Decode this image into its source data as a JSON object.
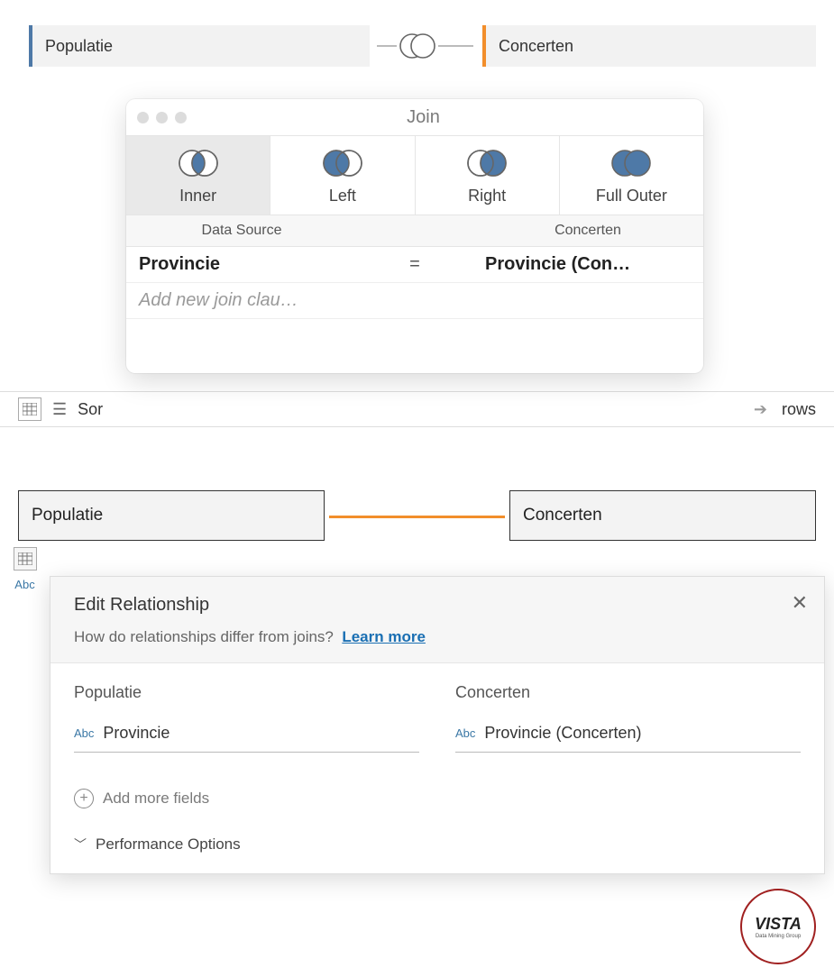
{
  "top": {
    "left_table": "Populatie",
    "right_table": "Concerten"
  },
  "join_popup": {
    "title": "Join",
    "types": [
      {
        "label": "Inner"
      },
      {
        "label": "Left"
      },
      {
        "label": "Right"
      },
      {
        "label": "Full Outer"
      }
    ],
    "headers": {
      "left": "Data Source",
      "right": "Concerten"
    },
    "clause": {
      "left": "Provincie",
      "op": "=",
      "right": "Provincie (Con…"
    },
    "add_placeholder": "Add new join clau…"
  },
  "toolstrip": {
    "sort_truncated": "Sor",
    "rows_label": "rows"
  },
  "relationship": {
    "left_table": "Populatie",
    "right_table": "Concerten",
    "title": "Edit Relationship",
    "subtitle": "How do relationships differ from joins?",
    "learn_more": "Learn more",
    "left_col": {
      "heading": "Populatie",
      "type": "Abc",
      "field": "Provincie"
    },
    "right_col": {
      "heading": "Concerten",
      "type": "Abc",
      "field": "Provincie (Concerten)"
    },
    "add_more": "Add more fields",
    "perf": "Performance Options"
  },
  "gutter": {
    "abc": "Abc"
  },
  "logo": {
    "name": "VISTA",
    "sub": "Data Mining Group"
  }
}
